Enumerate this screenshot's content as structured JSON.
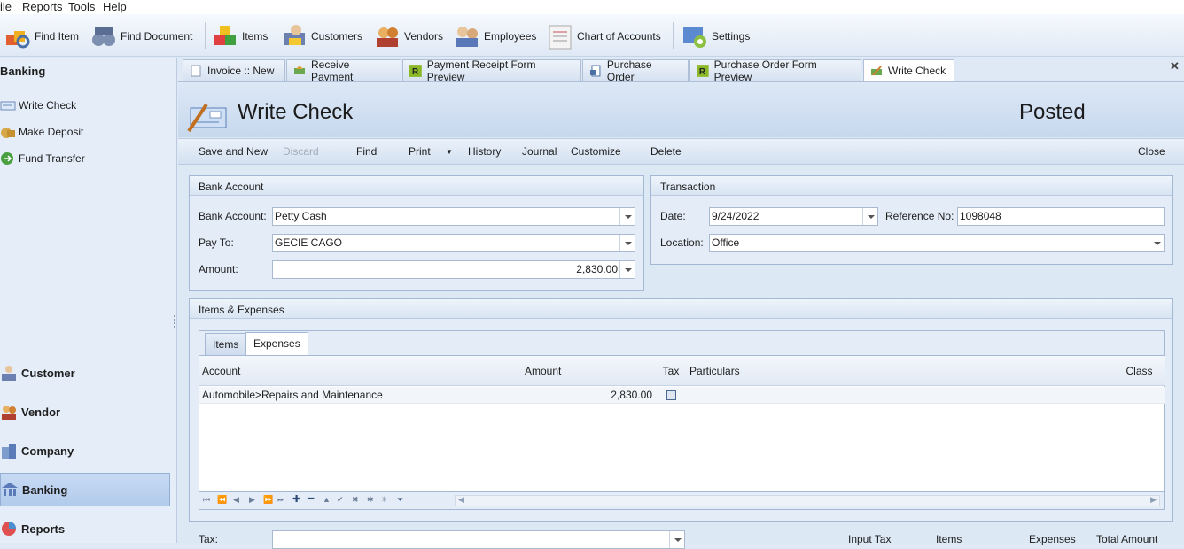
{
  "menu": [
    "ile",
    "Reports",
    "Tools",
    "Help"
  ],
  "toolbar": {
    "find_item": "Find Item",
    "find_document": "Find Document",
    "items": "Items",
    "customers": "Customers",
    "vendors": "Vendors",
    "employees": "Employees",
    "chart_of_accounts": "Chart of Accounts",
    "settings": "Settings"
  },
  "sidebar": {
    "header": "Banking",
    "items": [
      "Write Check",
      "Make Deposit",
      "Fund Transfer"
    ],
    "nav": [
      "Customer",
      "Vendor",
      "Company",
      "Banking",
      "Reports"
    ]
  },
  "tabs": [
    "Invoice :: New",
    "Receive Payment",
    "Payment Receipt Form Preview",
    "Purchase Order",
    "Purchase Order Form Preview",
    "Write Check"
  ],
  "form": {
    "title": "Write Check",
    "status": "Posted",
    "commands": {
      "save_new": "Save and New",
      "discard": "Discard",
      "find": "Find",
      "print": "Print",
      "history": "History",
      "journal": "Journal",
      "customize": "Customize",
      "delete": "Delete",
      "close": "Close"
    }
  },
  "bank_account": {
    "group_title": "Bank Account",
    "account_label": "Bank Account:",
    "account_value": "Petty Cash",
    "payto_label": "Pay To:",
    "payto_value": "GECIE CAGO",
    "amount_label": "Amount:",
    "amount_value": "2,830.00"
  },
  "transaction": {
    "group_title": "Transaction",
    "date_label": "Date:",
    "date_value": "9/24/2022",
    "ref_label": "Reference No:",
    "ref_value": "1098048",
    "location_label": "Location:",
    "location_value": "Office"
  },
  "items_expenses": {
    "group_title": "Items & Expenses",
    "tab_items": "Items",
    "tab_expenses": "Expenses",
    "columns": [
      "Account",
      "Amount",
      "Tax",
      "Particulars",
      "Class"
    ],
    "rows": [
      {
        "account": "Automobile>Repairs and Maintenance",
        "amount": "2,830.00",
        "tax": false,
        "particulars": "",
        "class": ""
      }
    ]
  },
  "footer": {
    "tax_label": "Tax:",
    "input_tax": "Input Tax",
    "items": "Items",
    "expenses": "Expenses",
    "total_amount": "Total Amount"
  }
}
